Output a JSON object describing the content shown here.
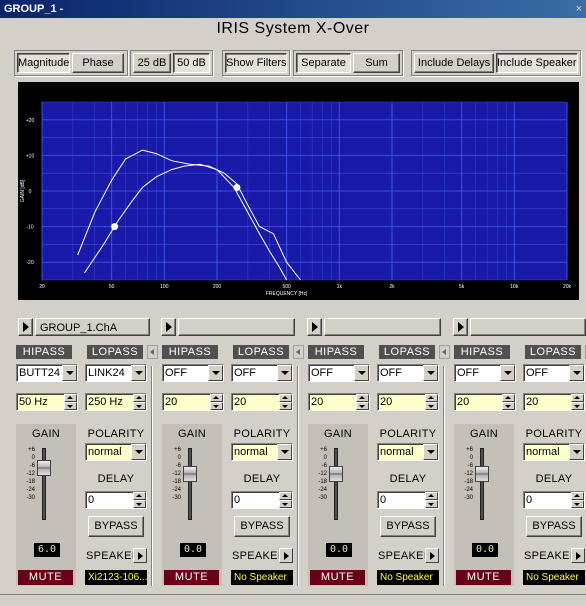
{
  "window": {
    "title": "GROUP_1 -",
    "close_glyph": "×"
  },
  "app_title": "IRIS System X-Over",
  "toolbar": {
    "magnitude": "Magnitude",
    "phase": "Phase",
    "db25": "25 dB",
    "db50": "50 dB",
    "show_filters": "Show Filters",
    "separate": "Separate",
    "sum": "Sum",
    "include_delays": "Include Delays",
    "include_speakers": "Include Speakers"
  },
  "graph": {
    "ylabel": "GAIN [dB]",
    "xlabel": "FREQUENCY [Hz]",
    "y_ticks": [
      "+20",
      "+10",
      "0",
      "-10",
      "-20"
    ],
    "x_ticks": [
      "20",
      "50",
      "100",
      "200",
      "500",
      "1k",
      "2k",
      "5k",
      "10k",
      "20k"
    ],
    "colors": {
      "background": "#1a1aa8",
      "grid": "#3c5cf0",
      "curve": "#ffffff"
    }
  },
  "chart_data": {
    "type": "line",
    "title": "",
    "xlabel": "FREQUENCY [Hz]",
    "ylabel": "GAIN [dB]",
    "xscale": "log",
    "xlim": [
      20,
      20000
    ],
    "ylim": [
      -25,
      25
    ],
    "grid": true,
    "series": [
      {
        "x": [
          35,
          45,
          55,
          65,
          75,
          90,
          110,
          130,
          160,
          200,
          250,
          300,
          350,
          400,
          450,
          500
        ],
        "y": [
          -23,
          -15,
          -8,
          -3,
          1,
          4,
          6,
          7,
          7.5,
          6,
          1,
          -6,
          -12,
          -17,
          -21,
          -25
        ]
      },
      {
        "x": [
          32,
          40,
          50,
          60,
          75,
          90,
          110,
          140,
          180,
          220,
          260,
          300,
          350,
          420,
          500,
          600
        ],
        "y": [
          -18,
          -6,
          3,
          9,
          11.5,
          10.5,
          8.5,
          7.5,
          7,
          5,
          2,
          -4,
          -10,
          -12,
          -20,
          -25
        ]
      }
    ],
    "markers": [
      {
        "x": 52,
        "y": -10
      },
      {
        "x": 260,
        "y": 1
      }
    ]
  },
  "channel_selector": {
    "name": "GROUP_1.ChA"
  },
  "channels": [
    {
      "hipass_label": "HIPASS",
      "lopass_label": "LOPASS",
      "hp_type": "BUTT24",
      "lp_type": "LINK24",
      "hp_freq": "50 Hz",
      "lp_freq": "250 Hz",
      "gain_label": "GAIN",
      "polarity_label": "POLARITY",
      "polarity": "normal",
      "delay_label": "DELAY",
      "delay": "0",
      "bypass": "BYPASS",
      "gain_value": "6.0",
      "speaker_label": "SPEAKER",
      "speaker": "Xi2123-106...",
      "mute": "MUTE",
      "fader_level": 0.72
    },
    {
      "hipass_label": "HIPASS",
      "lopass_label": "LOPASS",
      "hp_type": "OFF",
      "lp_type": "OFF",
      "hp_freq": "20",
      "lp_freq": "20",
      "gain_label": "GAIN",
      "polarity_label": "POLARITY",
      "polarity": "normal",
      "delay_label": "DELAY",
      "delay": "0",
      "bypass": "BYPASS",
      "gain_value": "0.0",
      "speaker_label": "SPEAKER",
      "speaker": "No Speaker",
      "mute": "MUTE",
      "fader_level": 0.6
    },
    {
      "hipass_label": "HIPASS",
      "lopass_label": "LOPASS",
      "hp_type": "OFF",
      "lp_type": "OFF",
      "hp_freq": "20",
      "lp_freq": "20",
      "gain_label": "GAIN",
      "polarity_label": "POLARITY",
      "polarity": "normal",
      "delay_label": "DELAY",
      "delay": "0",
      "bypass": "BYPASS",
      "gain_value": "0.0",
      "speaker_label": "SPEAKER",
      "speaker": "No Speaker",
      "mute": "MUTE",
      "fader_level": 0.6
    },
    {
      "hipass_label": "HIPASS",
      "lopass_label": "LOPASS",
      "hp_type": "OFF",
      "lp_type": "OFF",
      "hp_freq": "20",
      "lp_freq": "20",
      "gain_label": "GAIN",
      "polarity_label": "POLARITY",
      "polarity": "normal",
      "delay_label": "DELAY",
      "delay": "0",
      "bypass": "BYPASS",
      "gain_value": "0.0",
      "speaker_label": "SPEAKER",
      "speaker": "No Speaker",
      "mute": "MUTE",
      "fader_level": 0.6
    }
  ],
  "scale_labels": [
    "+6",
    "0",
    "-6",
    "-12",
    "-18",
    "-24",
    "-30"
  ]
}
